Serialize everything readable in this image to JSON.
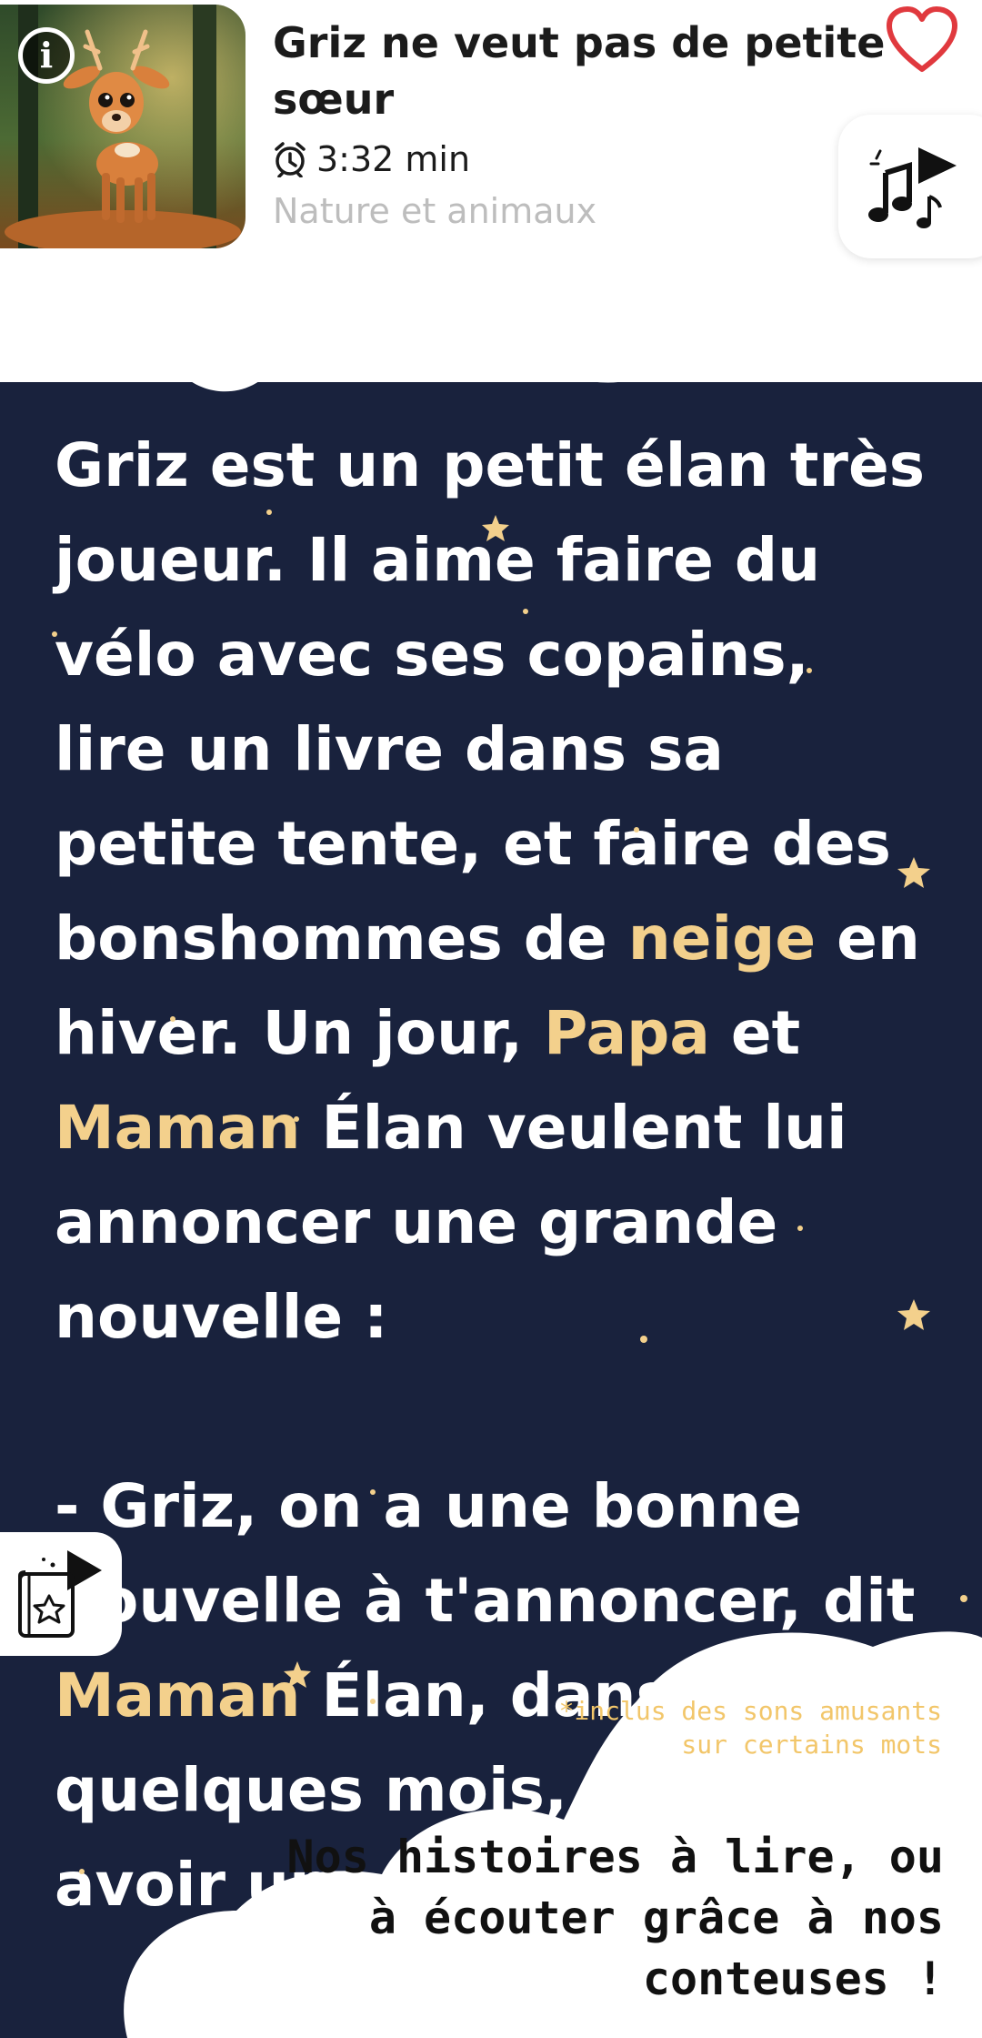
{
  "story_header": {
    "title": "Griz ne veut pas de petite sœur",
    "duration": "3:32 min",
    "category": "Nature et animaux"
  },
  "icons": {
    "info": "info-icon",
    "favorite": "heart-outline-icon",
    "clock": "alarm-clock-icon",
    "music": "music-play-icon",
    "book": "storybook-play-icon"
  },
  "story_text": {
    "p1_a": "Griz est un petit élan très joueur. Il aime faire du vélo avec ses copains, lire un livre dans sa petite tente, et faire des bonshommes de ",
    "p1_w1": "neige",
    "p1_b": " en hiver. Un jour, ",
    "p1_w2": "Papa",
    "p1_c": " et ",
    "p1_w3": "Maman",
    "p1_d": " Élan veulent lui annoncer une grande nouvelle :",
    "p2_a": "- Griz, on a une bonne nouvelle à t'annoncer, dit ",
    "p2_w1": "Maman",
    "p2_b": " Élan, dans quelques mois, tu vas avoir un"
  },
  "promo": {
    "note": "*inclus des sons amusants sur certains mots",
    "headline": "Nos histoires à lire, ou à écouter grâce à nos conteuses !"
  },
  "colors": {
    "night": "#19223d",
    "highlight": "#f3d08c",
    "promo_note": "#f2c66a",
    "heart": "#e0393e"
  }
}
